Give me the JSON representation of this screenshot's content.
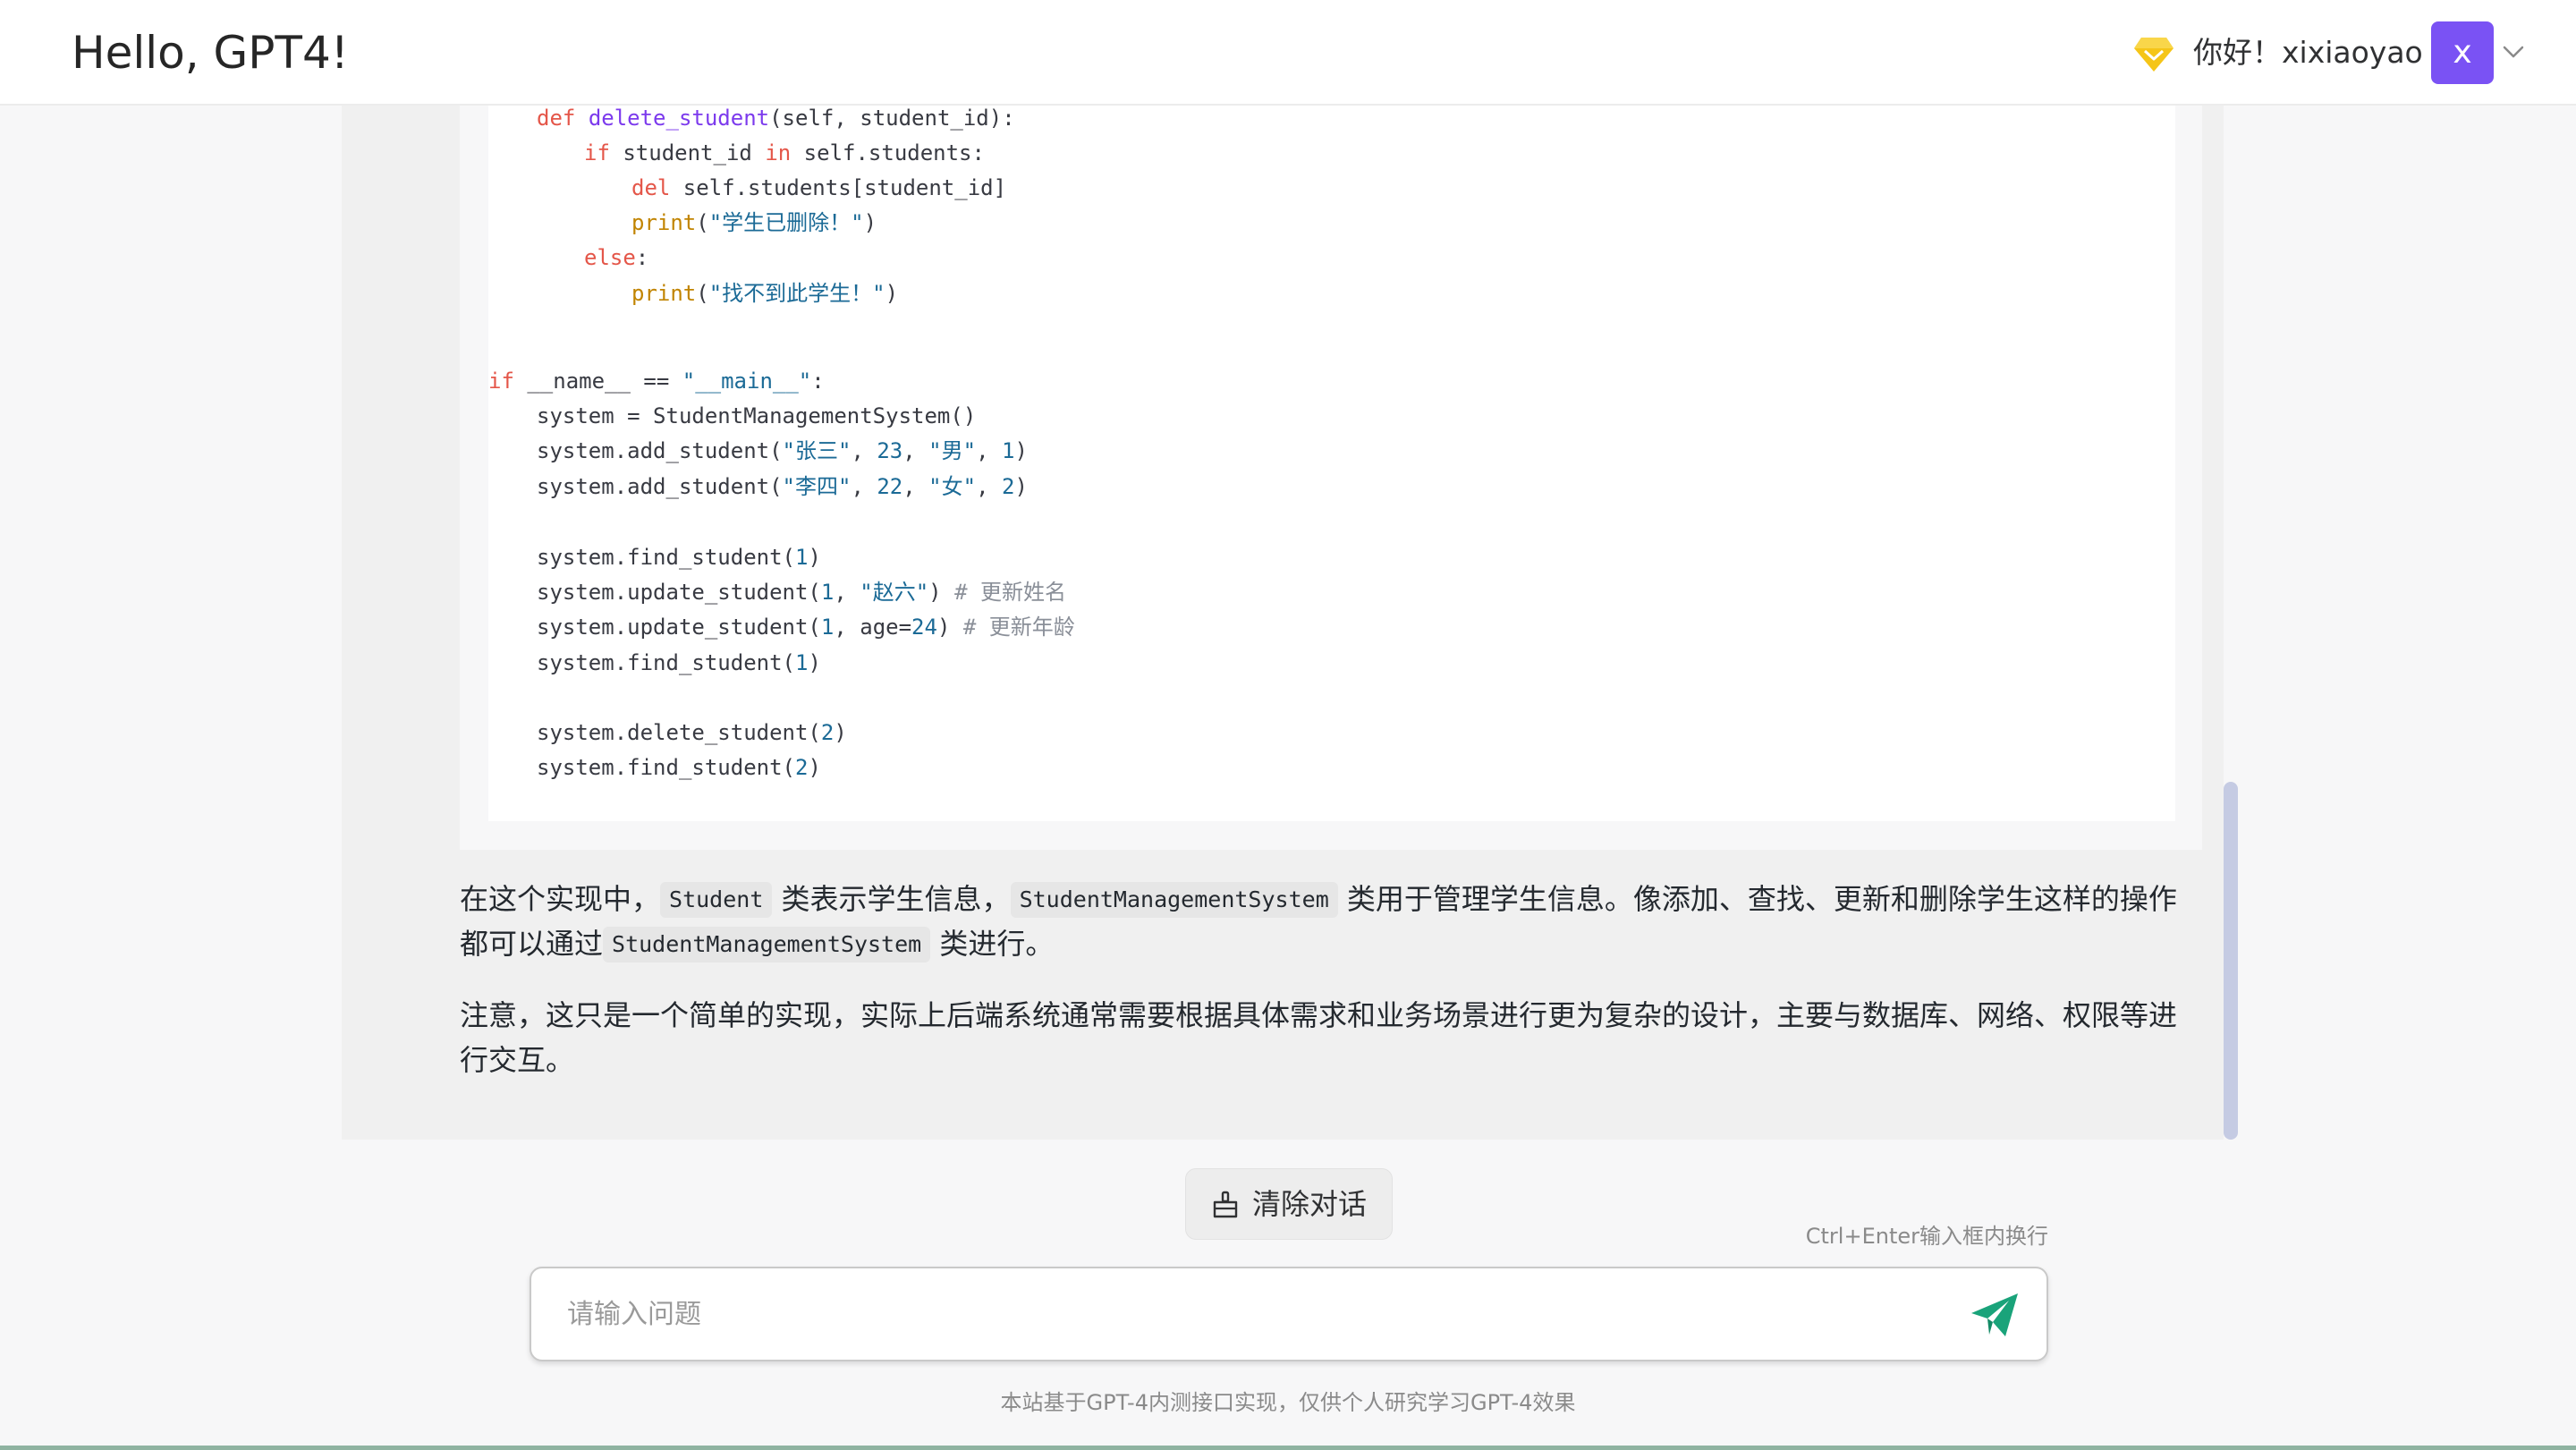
{
  "header": {
    "title": "Hello, GPT4!",
    "greeting": "你好！xixiaoyao",
    "avatar_letter": "x",
    "vip_icon": "diamond-icon",
    "vip_color": "#f5c518",
    "avatar_color": "#7a52f4"
  },
  "code": {
    "lines": {
      "l0": {
        "kw": "def",
        "fname": "delete_student",
        "rest": "(self, student_id):"
      },
      "l1": {
        "kw": "if",
        "a": "student_id ",
        "b": " self.students:",
        "kw2": "in"
      },
      "l2": {
        "kw": "del",
        "rest": " self.students[student_id]"
      },
      "l3": {
        "fn": "print",
        "open": "(",
        "str": "\"学生已删除！\"",
        "close": ")"
      },
      "l4": {
        "kw": "else",
        "rest": ":"
      },
      "l5": {
        "fn": "print",
        "open": "(",
        "str": "\"找不到此学生！\"",
        "close": ")"
      },
      "l6": {
        "kw": "if",
        "a": " __name__ == ",
        "str": "\"__main__\"",
        "rest": ":"
      },
      "l7": {
        "rest": "system = StudentManagementSystem()"
      },
      "l8": {
        "a": "system.add_student(",
        "s1": "\"张三\"",
        "c1": ", ",
        "n1": "23",
        "c2": ", ",
        "s2": "\"男\"",
        "c3": ", ",
        "n2": "1",
        "close": ")"
      },
      "l9": {
        "a": "system.add_student(",
        "s1": "\"李四\"",
        "c1": ", ",
        "n1": "22",
        "c2": ", ",
        "s2": "\"女\"",
        "c3": ", ",
        "n2": "2",
        "close": ")"
      },
      "l10": {
        "a": "system.find_student(",
        "n1": "1",
        "close": ")"
      },
      "l11": {
        "a": "system.update_student(",
        "n1": "1",
        "c1": ", ",
        "s1": "\"赵六\"",
        "close": ") ",
        "cmt": "# 更新姓名"
      },
      "l12": {
        "a": "system.update_student(",
        "n1": "1",
        "c1": ", age=",
        "n2": "24",
        "close": ") ",
        "cmt": "# 更新年龄"
      },
      "l13": {
        "a": "system.find_student(",
        "n1": "1",
        "close": ")"
      },
      "l14": {
        "a": "system.delete_student(",
        "n1": "2",
        "close": ")"
      },
      "l15": {
        "a": "system.find_student(",
        "n1": "2",
        "close": ")"
      }
    }
  },
  "answer": {
    "p1_a": "在这个实现中，",
    "p1_code1": "Student",
    "p1_b": "类表示学生信息，",
    "p1_code2": "StudentManagementSystem",
    "p1_c": "类用于管理学生信息。像添加、查找、更新和删除学生这样的操作都可以通过",
    "p1_code3": "StudentManagementSystem",
    "p1_d": "类进行。",
    "p2": "注意，这只是一个简单的实现，实际上后端系统通常需要根据具体需求和业务场景进行更为复杂的设计，主要与数据库、网络、权限等进行交互。"
  },
  "controls": {
    "clear_label": "清除对话",
    "clear_icon": "broom-icon",
    "hint": "Ctrl+Enter输入框内换行",
    "input_placeholder": "请输入问题",
    "input_value": "",
    "send_icon": "send-icon",
    "send_color": "#1aa37a"
  },
  "footer": {
    "note": "本站基于GPT-4内测接口实现，仅供个人研究学习GPT-4效果"
  }
}
